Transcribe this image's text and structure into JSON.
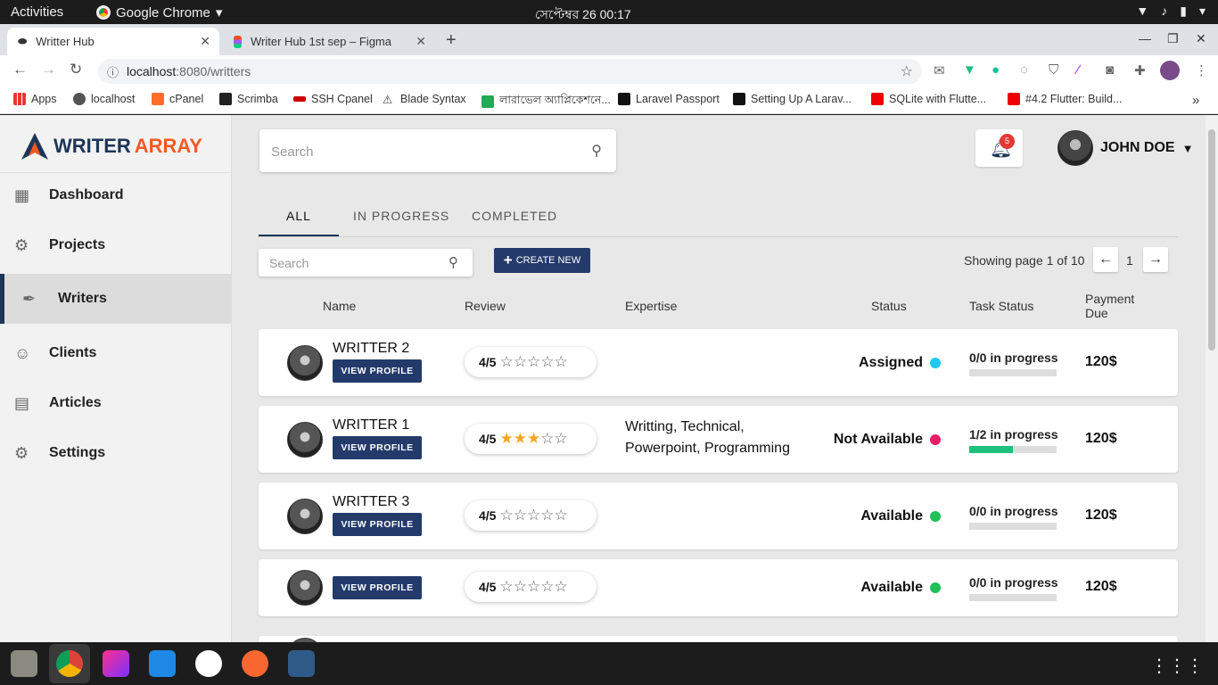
{
  "system": {
    "activities": "Activities",
    "app_name": "Google Chrome",
    "clock": "সেপ্টেম্বর 26  00:17"
  },
  "browser": {
    "tabs": [
      {
        "title": "Writter Hub",
        "active": true
      },
      {
        "title": "Writer Hub 1st sep – Figma",
        "active": false
      }
    ],
    "url_host": "localhost",
    "url_path": ":8080/writters",
    "bookmarks": [
      "Apps",
      "localhost",
      "cPanel",
      "Scrimba",
      "SSH Cpanel",
      "Blade Syntax",
      "লারাভেল অ্যাপ্লিকেশনে...",
      "Laravel Passport",
      "Setting Up A Larav...",
      "SQLite with Flutte...",
      "#4.2 Flutter: Build..."
    ]
  },
  "brand": {
    "writer": "WRITER",
    "array": "ARRAY",
    "color_dark": "#1d3557",
    "color_accent": "#f15a24"
  },
  "sidebar": {
    "items": [
      {
        "label": "Dashboard",
        "icon": "dashboard-icon"
      },
      {
        "label": "Projects",
        "icon": "gear-outline-icon"
      },
      {
        "label": "Writers",
        "icon": "pen-icon",
        "active": true
      },
      {
        "label": "Clients",
        "icon": "client-icon"
      },
      {
        "label": "Articles",
        "icon": "article-icon"
      },
      {
        "label": "Settings",
        "icon": "settings-icon"
      }
    ]
  },
  "header": {
    "search_placeholder": "Search",
    "notification_count": "5",
    "user_name": "JOHN DOE"
  },
  "filter_tabs": [
    "ALL",
    "IN PROGRESS",
    "COMPLETED"
  ],
  "toolbar": {
    "search_placeholder": "Search",
    "create_label": "CREATE NEW",
    "page_info": "Showing page 1 of 10",
    "page_number": "1"
  },
  "columns": [
    "Name",
    "Review",
    "Expertise",
    "Status",
    "Task Status",
    "Payment Due"
  ],
  "writers": [
    {
      "name": "WRITTER 2",
      "button": "VIEW PROFILE",
      "review": "4/5",
      "stars": 0,
      "expertise": [],
      "status": "Assigned",
      "status_color": "#1ec8f0",
      "task": "0/0 in progress",
      "progress": 0,
      "payment": "120$"
    },
    {
      "name": "WRITTER 1",
      "button": "VIEW PROFILE",
      "review": "4/5",
      "stars": 3,
      "expertise": [
        "Writting, Technical,",
        "Powerpoint, Programming"
      ],
      "status": "Not Available",
      "status_color": "#e91e63",
      "task": "1/2 in progress",
      "progress": 0.5,
      "payment": "120$"
    },
    {
      "name": "WRITTER 3",
      "button": "VIEW PROFILE",
      "review": "4/5",
      "stars": 0,
      "expertise": [],
      "status": "Available",
      "status_color": "#1ec05a",
      "task": "0/0 in progress",
      "progress": 0,
      "payment": "120$"
    },
    {
      "name": "",
      "button": "VIEW PROFILE",
      "review": "4/5",
      "stars": 0,
      "expertise": [],
      "status": "Available",
      "status_color": "#1ec05a",
      "task": "0/0 in progress",
      "progress": 0,
      "payment": "120$"
    }
  ]
}
